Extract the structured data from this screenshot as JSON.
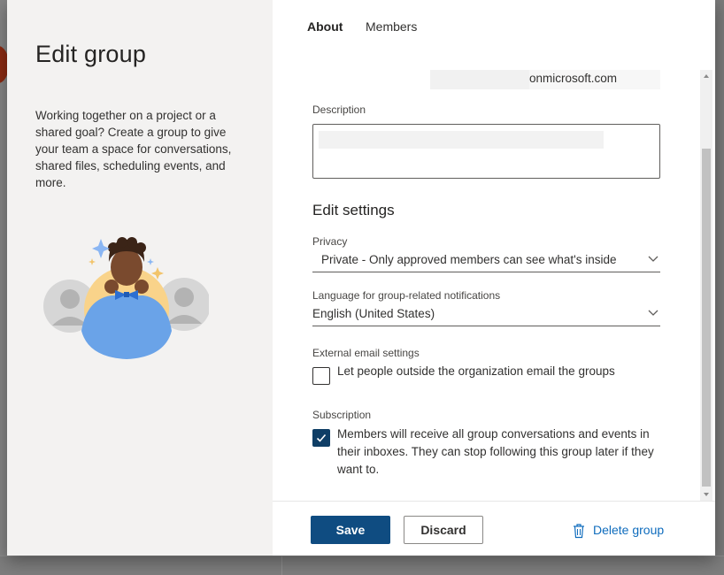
{
  "dialog": {
    "title": "Edit group",
    "intro": "Working together on a project or a shared goal? Create a group to give your team a space for conversations, shared files, scheduling events, and more."
  },
  "tabs": [
    {
      "label": "About",
      "active": true
    },
    {
      "label": "Members",
      "active": false
    }
  ],
  "group": {
    "email_suffix": "onmicrosoft.com"
  },
  "description": {
    "label": "Description",
    "value": ""
  },
  "settings": {
    "section_title": "Edit settings",
    "privacy": {
      "label": "Privacy",
      "value": "Private - Only approved members can see what's inside"
    },
    "language": {
      "label": "Language for group-related notifications",
      "value": "English (United States)"
    },
    "external_email": {
      "label": "External email settings",
      "checkbox_label": "Let people outside the organization email the groups",
      "checked": false
    },
    "subscription": {
      "label": "Subscription",
      "checkbox_label": "Members will receive all group conversations and events in their inboxes. They can stop following this group later if they want to.",
      "checked": true
    }
  },
  "footer": {
    "save_label": "Save",
    "discard_label": "Discard",
    "delete_label": "Delete group"
  },
  "colors": {
    "primary": "#0f4c81",
    "link": "#0f6cbd",
    "checkbox_checked": "#0f3e66",
    "left_pane": "#f3f2f1"
  }
}
